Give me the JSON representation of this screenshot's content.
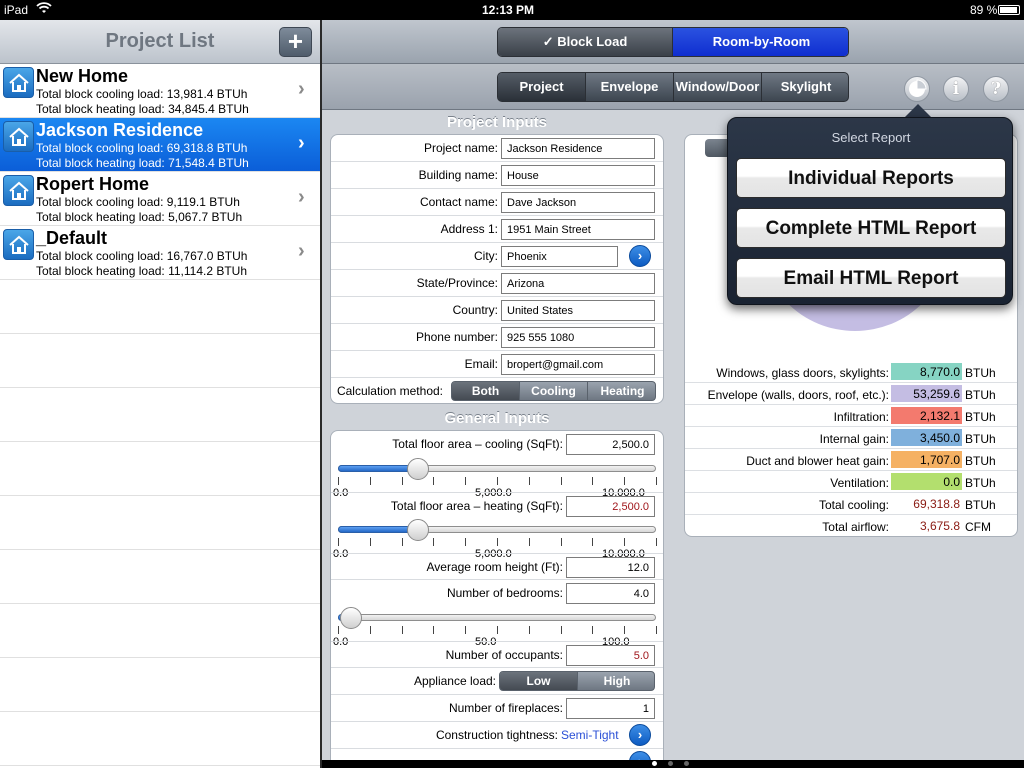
{
  "status": {
    "carrier": "iPad",
    "time": "12:13 PM",
    "battery": "89 %"
  },
  "project_list": {
    "title": "Project List",
    "add_label": "+",
    "items": [
      {
        "name": "New Home",
        "cooling": "Total block cooling load: 13,981.4 BTUh",
        "heating": "Total block heating load: 34,845.4 BTUh",
        "selected": false
      },
      {
        "name": "Jackson Residence",
        "cooling": "Total block cooling load: 69,318.8 BTUh",
        "heating": "Total block heating load: 71,548.4 BTUh",
        "selected": true
      },
      {
        "name": "Ropert Home",
        "cooling": "Total block cooling load: 9,119.1 BTUh",
        "heating": "Total block heating load: 5,067.7 BTUh",
        "selected": false
      },
      {
        "name": "_Default",
        "cooling": "Total block cooling load: 16,767.0 BTUh",
        "heating": "Total block heating load: 11,114.2 BTUh",
        "selected": false
      }
    ]
  },
  "mode_toggle": {
    "block_load": "✓ Block Load",
    "room_by_room": "Room-by-Room",
    "selected": "block_load"
  },
  "tabs": [
    {
      "label": "Project",
      "selected": true
    },
    {
      "label": "Envelope",
      "selected": false
    },
    {
      "label": "Window/Door",
      "selected": false
    },
    {
      "label": "Skylight",
      "selected": false
    }
  ],
  "toolbar_icons": {
    "report": "pie-chart-icon",
    "info": "i",
    "help": "?"
  },
  "project_inputs": {
    "title": "Project Inputs",
    "fields": [
      {
        "label": "Project name:",
        "value": "Jackson Residence"
      },
      {
        "label": "Building name:",
        "value": "House"
      },
      {
        "label": "Contact name:",
        "value": "Dave Jackson"
      },
      {
        "label": "Address 1:",
        "value": "1951 Main Street"
      },
      {
        "label": "City:",
        "value": "Phoenix"
      },
      {
        "label": "State/Province:",
        "value": "Arizona"
      },
      {
        "label": "Country:",
        "value": "United States"
      },
      {
        "label": "Phone number:",
        "value": "925 555 1080"
      },
      {
        "label": "Email:",
        "value": "bropert@gmail.com"
      }
    ],
    "calc_method": {
      "label": "Calculation method:",
      "options": [
        "Both",
        "Cooling",
        "Heating"
      ],
      "selected": "Both"
    }
  },
  "general_inputs": {
    "title": "General Inputs",
    "floor_cooling": {
      "label": "Total floor area – cooling (SqFt):",
      "value": "2,500.0",
      "slider_fraction": 0.25,
      "min": "0.0",
      "mid": "5,000.0",
      "max": "10,000.0"
    },
    "floor_heating": {
      "label": "Total floor area – heating (SqFt):",
      "value": "2,500.0",
      "slider_fraction": 0.25,
      "min": "0.0",
      "mid": "5,000.0",
      "max": "10,000.0"
    },
    "room_height": {
      "label": "Average room height (Ft):",
      "value": "12.0"
    },
    "bedrooms": {
      "label": "Number of bedrooms:",
      "value": "4.0",
      "slider_fraction": 0.04,
      "min": "0.0",
      "mid": "50.0",
      "max": "100.0"
    },
    "occupants": {
      "label": "Number of occupants:",
      "value": "5.0"
    },
    "appliance": {
      "label": "Appliance load:",
      "options": [
        "Low",
        "High"
      ],
      "selected": "Low"
    },
    "fireplaces": {
      "label": "Number of fireplaces:",
      "value": "1"
    },
    "tightness": {
      "label": "Construction tightness:",
      "value": "Semi-Tight"
    }
  },
  "report": {
    "rows": [
      {
        "label": "Windows, glass doors, skylights:",
        "value": "8,770.0",
        "unit": "BTUh",
        "color": "#86d4c3"
      },
      {
        "label": "Envelope (walls, doors, roof, etc.):",
        "value": "53,259.6",
        "unit": "BTUh",
        "color": "#c4bde3"
      },
      {
        "label": "Infiltration:",
        "value": "2,132.1",
        "unit": "BTUh",
        "color": "#f37a6e"
      },
      {
        "label": "Internal gain:",
        "value": "3,450.0",
        "unit": "BTUh",
        "color": "#7fb0dc"
      },
      {
        "label": "Duct and blower heat gain:",
        "value": "1,707.0",
        "unit": "BTUh",
        "color": "#f5b163"
      },
      {
        "label": "Ventilation:",
        "value": "0.0",
        "unit": "BTUh",
        "color": "#b3df6e"
      },
      {
        "label": "Total cooling:",
        "value": "69,318.8",
        "unit": "BTUh",
        "color": ""
      },
      {
        "label": "Total airflow:",
        "value": "3,675.8",
        "unit": "CFM",
        "color": ""
      }
    ]
  },
  "popover": {
    "title": "Select Report",
    "buttons": [
      "Individual Reports",
      "Complete HTML Report",
      "Email HTML Report"
    ]
  }
}
